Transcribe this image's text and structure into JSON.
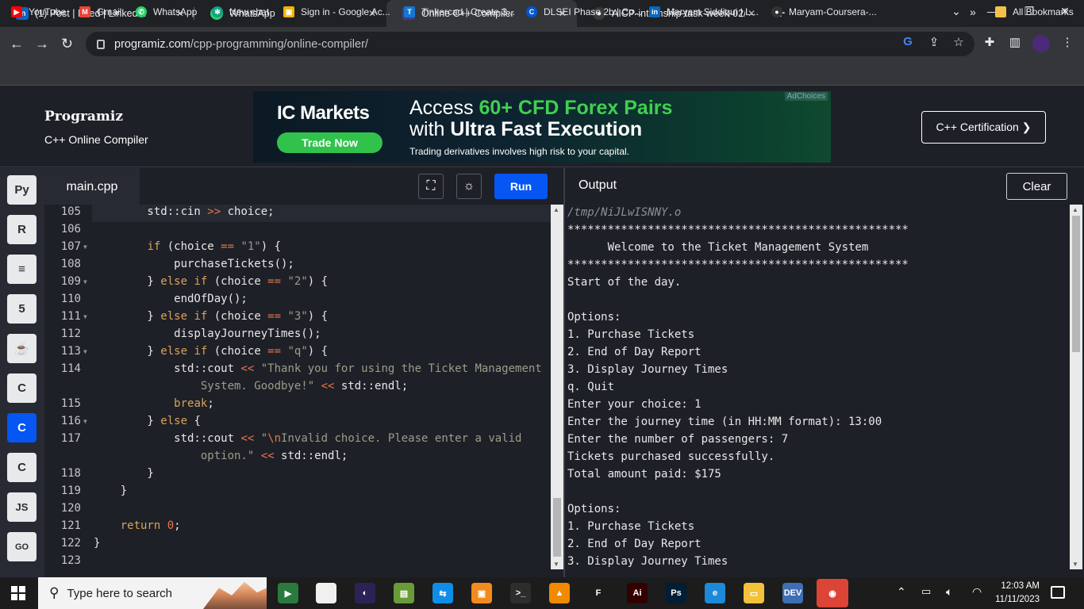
{
  "browser": {
    "tabs": [
      {
        "label": "(1) Post | Feed | LinkedIn",
        "icon": "linkedin-icon"
      },
      {
        "label": "WhatsApp",
        "icon": "whatsapp-icon"
      },
      {
        "label": "Online C++ Compiler",
        "icon": "programiz-icon",
        "active": true
      },
      {
        "label": "AICP-internship-task-week-02/",
        "icon": "github-icon"
      }
    ],
    "url_domain": "programiz.com",
    "url_path": "/cpp-programming/online-compiler/",
    "bookmarks": [
      {
        "label": "YouTube",
        "icon": "youtube-icon",
        "color": "#ff0000"
      },
      {
        "label": "Gmail",
        "icon": "gmail-icon",
        "color": "#ea4335"
      },
      {
        "label": "WhatsApp",
        "icon": "whatsapp-icon",
        "color": "#25d366"
      },
      {
        "label": "New chat",
        "icon": "openai-icon",
        "color": "#10a37f"
      },
      {
        "label": "Sign in - Google Ac...",
        "icon": "google-classroom-icon",
        "color": "#f4b400"
      },
      {
        "label": "Tinkercad | Create 3...",
        "icon": "tinkercad-icon",
        "color": "#1477d1"
      },
      {
        "label": "DLSEI Phase 2b | Co...",
        "icon": "coursera-icon",
        "color": "#0056d2"
      },
      {
        "label": "Maryam Siddiqui | L...",
        "icon": "linkedin-icon",
        "color": "#0a66c2"
      },
      {
        "label": "Maryam-Coursera-...",
        "icon": "github-icon",
        "color": "#333333"
      }
    ],
    "more_bookmarks": "»",
    "all_bookmarks": "All Bookmarks"
  },
  "header": {
    "logo": "Programiz",
    "subtitle": "C++ Online Compiler",
    "cert_button": "C++ Certification ❯"
  },
  "ad": {
    "brand": "IC Markets",
    "cta": "Trade Now",
    "headline_pre": "Access ",
    "headline_green": "60+ CFD Forex Pairs",
    "headline2_pre": "with ",
    "headline2_bold": "Ultra Fast Execution",
    "disclaimer": "Trading derivatives involves high risk to your capital.",
    "choices": "AdChoices"
  },
  "sidebar": {
    "items": [
      {
        "icon": "python-icon",
        "glyph": "Py"
      },
      {
        "icon": "r-lang-icon",
        "glyph": "R"
      },
      {
        "icon": "sql-database-icon",
        "glyph": "≡"
      },
      {
        "icon": "html5-icon",
        "glyph": "5"
      },
      {
        "icon": "java-icon",
        "glyph": "☕"
      },
      {
        "icon": "c-lang-icon",
        "glyph": "C"
      },
      {
        "icon": "cpp-lang-icon",
        "glyph": "C",
        "active": true
      },
      {
        "icon": "csharp-icon",
        "glyph": "C"
      },
      {
        "icon": "javascript-icon",
        "glyph": "JS"
      },
      {
        "icon": "go-lang-icon",
        "glyph": "GO"
      }
    ]
  },
  "editor": {
    "filename": "main.cpp",
    "run_label": "Run",
    "lines": [
      {
        "n": "105",
        "fold": false,
        "html": "        std::cin <span class='op'>&gt;&gt;</span> choice;"
      },
      {
        "n": "106",
        "fold": false,
        "html": ""
      },
      {
        "n": "107",
        "fold": true,
        "html": "        <span class='kw'>if</span> (choice <span class='op'>==</span> <span class='str'>\"1\"</span>) {"
      },
      {
        "n": "108",
        "fold": false,
        "html": "            purchaseTickets();"
      },
      {
        "n": "109",
        "fold": true,
        "html": "        } <span class='kw'>else if</span> (choice <span class='op'>==</span> <span class='str'>\"2\"</span>) {"
      },
      {
        "n": "110",
        "fold": false,
        "html": "            endOfDay();"
      },
      {
        "n": "111",
        "fold": true,
        "html": "        } <span class='kw'>else if</span> (choice <span class='op'>==</span> <span class='str'>\"3\"</span>) {"
      },
      {
        "n": "112",
        "fold": false,
        "html": "            displayJourneyTimes();"
      },
      {
        "n": "113",
        "fold": true,
        "html": "        } <span class='kw'>else if</span> (choice <span class='op'>==</span> <span class='str'>\"q\"</span>) {"
      },
      {
        "n": "114",
        "fold": false,
        "html": "            std::cout <span class='op'>&lt;&lt;</span> <span class='str'>\"Thank you for using the Ticket Management</span>"
      },
      {
        "n": "",
        "fold": false,
        "html": "                <span class='str'>System. Goodbye!\"</span> <span class='op'>&lt;&lt;</span> std::endl;"
      },
      {
        "n": "115",
        "fold": false,
        "html": "            <span class='kw'>break</span>;"
      },
      {
        "n": "116",
        "fold": true,
        "html": "        } <span class='kw'>else</span> {"
      },
      {
        "n": "117",
        "fold": false,
        "html": "            std::cout <span class='op'>&lt;&lt;</span> <span class='str'>\"</span><span class='esc'>\\n</span><span class='str'>Invalid choice. Please enter a valid</span>"
      },
      {
        "n": "",
        "fold": false,
        "html": "                <span class='str'>option.\"</span> <span class='op'>&lt;&lt;</span> std::endl;"
      },
      {
        "n": "118",
        "fold": false,
        "html": "        }"
      },
      {
        "n": "119",
        "fold": false,
        "html": "    }"
      },
      {
        "n": "120",
        "fold": false,
        "html": ""
      },
      {
        "n": "121",
        "fold": false,
        "html": "    <span class='kw'>return</span> <span class='num'>0</span>;"
      },
      {
        "n": "122",
        "fold": false,
        "html": "}"
      },
      {
        "n": "123",
        "fold": false,
        "html": ""
      }
    ]
  },
  "output": {
    "title": "Output",
    "clear_label": "Clear",
    "lines": [
      "/tmp/NiJLwISNNY.o",
      "***************************************************",
      "      Welcome to the Ticket Management System",
      "***************************************************",
      "Start of the day.",
      "",
      "Options:",
      "1. Purchase Tickets",
      "2. End of Day Report",
      "3. Display Journey Times",
      "q. Quit",
      "Enter your choice: 1",
      "Enter the journey time (in HH:MM format): 13:00",
      "Enter the number of passengers: 7",
      "Tickets purchased successfully.",
      "Total amount paid: $175",
      "",
      "Options:",
      "1. Purchase Tickets",
      "2. End of Day Report",
      "3. Display Journey Times"
    ]
  },
  "taskbar": {
    "search_placeholder": "Type here to search",
    "apps": [
      {
        "icon": "video-editor-icon",
        "glyph": "▶",
        "bg": "#2b7a3d"
      },
      {
        "icon": "notepad-icon",
        "glyph": "",
        "bg": "#f0f0f0"
      },
      {
        "icon": "eclipse-icon",
        "glyph": "◐",
        "bg": "#2c2255"
      },
      {
        "icon": "spreadsheet-icon",
        "glyph": "▤",
        "bg": "#6a9a3a"
      },
      {
        "icon": "teamviewer-icon",
        "glyph": "⇆",
        "bg": "#0e8ee9"
      },
      {
        "icon": "app-orange-icon",
        "glyph": "▣",
        "bg": "#f28b1d"
      },
      {
        "icon": "terminal-icon",
        "glyph": ">_",
        "bg": "#2d2d2d"
      },
      {
        "icon": "vlc-icon",
        "glyph": "▲",
        "bg": "#f08a00"
      },
      {
        "icon": "figma-icon",
        "glyph": "F",
        "bg": "#1c1c1c"
      },
      {
        "icon": "illustrator-icon",
        "glyph": "Ai",
        "bg": "#330000"
      },
      {
        "icon": "photoshop-icon",
        "glyph": "Ps",
        "bg": "#001e36"
      },
      {
        "icon": "edge-icon",
        "glyph": "e",
        "bg": "#1c8ad8"
      },
      {
        "icon": "file-explorer-icon",
        "glyph": "▭",
        "bg": "#f3c13a"
      },
      {
        "icon": "devcpp-icon",
        "glyph": "DEV",
        "bg": "#3d6fb4"
      },
      {
        "icon": "chrome-icon",
        "glyph": "◉",
        "bg": "#db4437",
        "active": true
      }
    ],
    "time": "12:03 AM",
    "date": "11/11/2023"
  },
  "colors": {
    "accent": "#0556f3",
    "editor_bg": "#1e2027",
    "sidebar_bg": "#272a33",
    "keyword": "#d9a35a",
    "string": "#9b9d8a"
  }
}
